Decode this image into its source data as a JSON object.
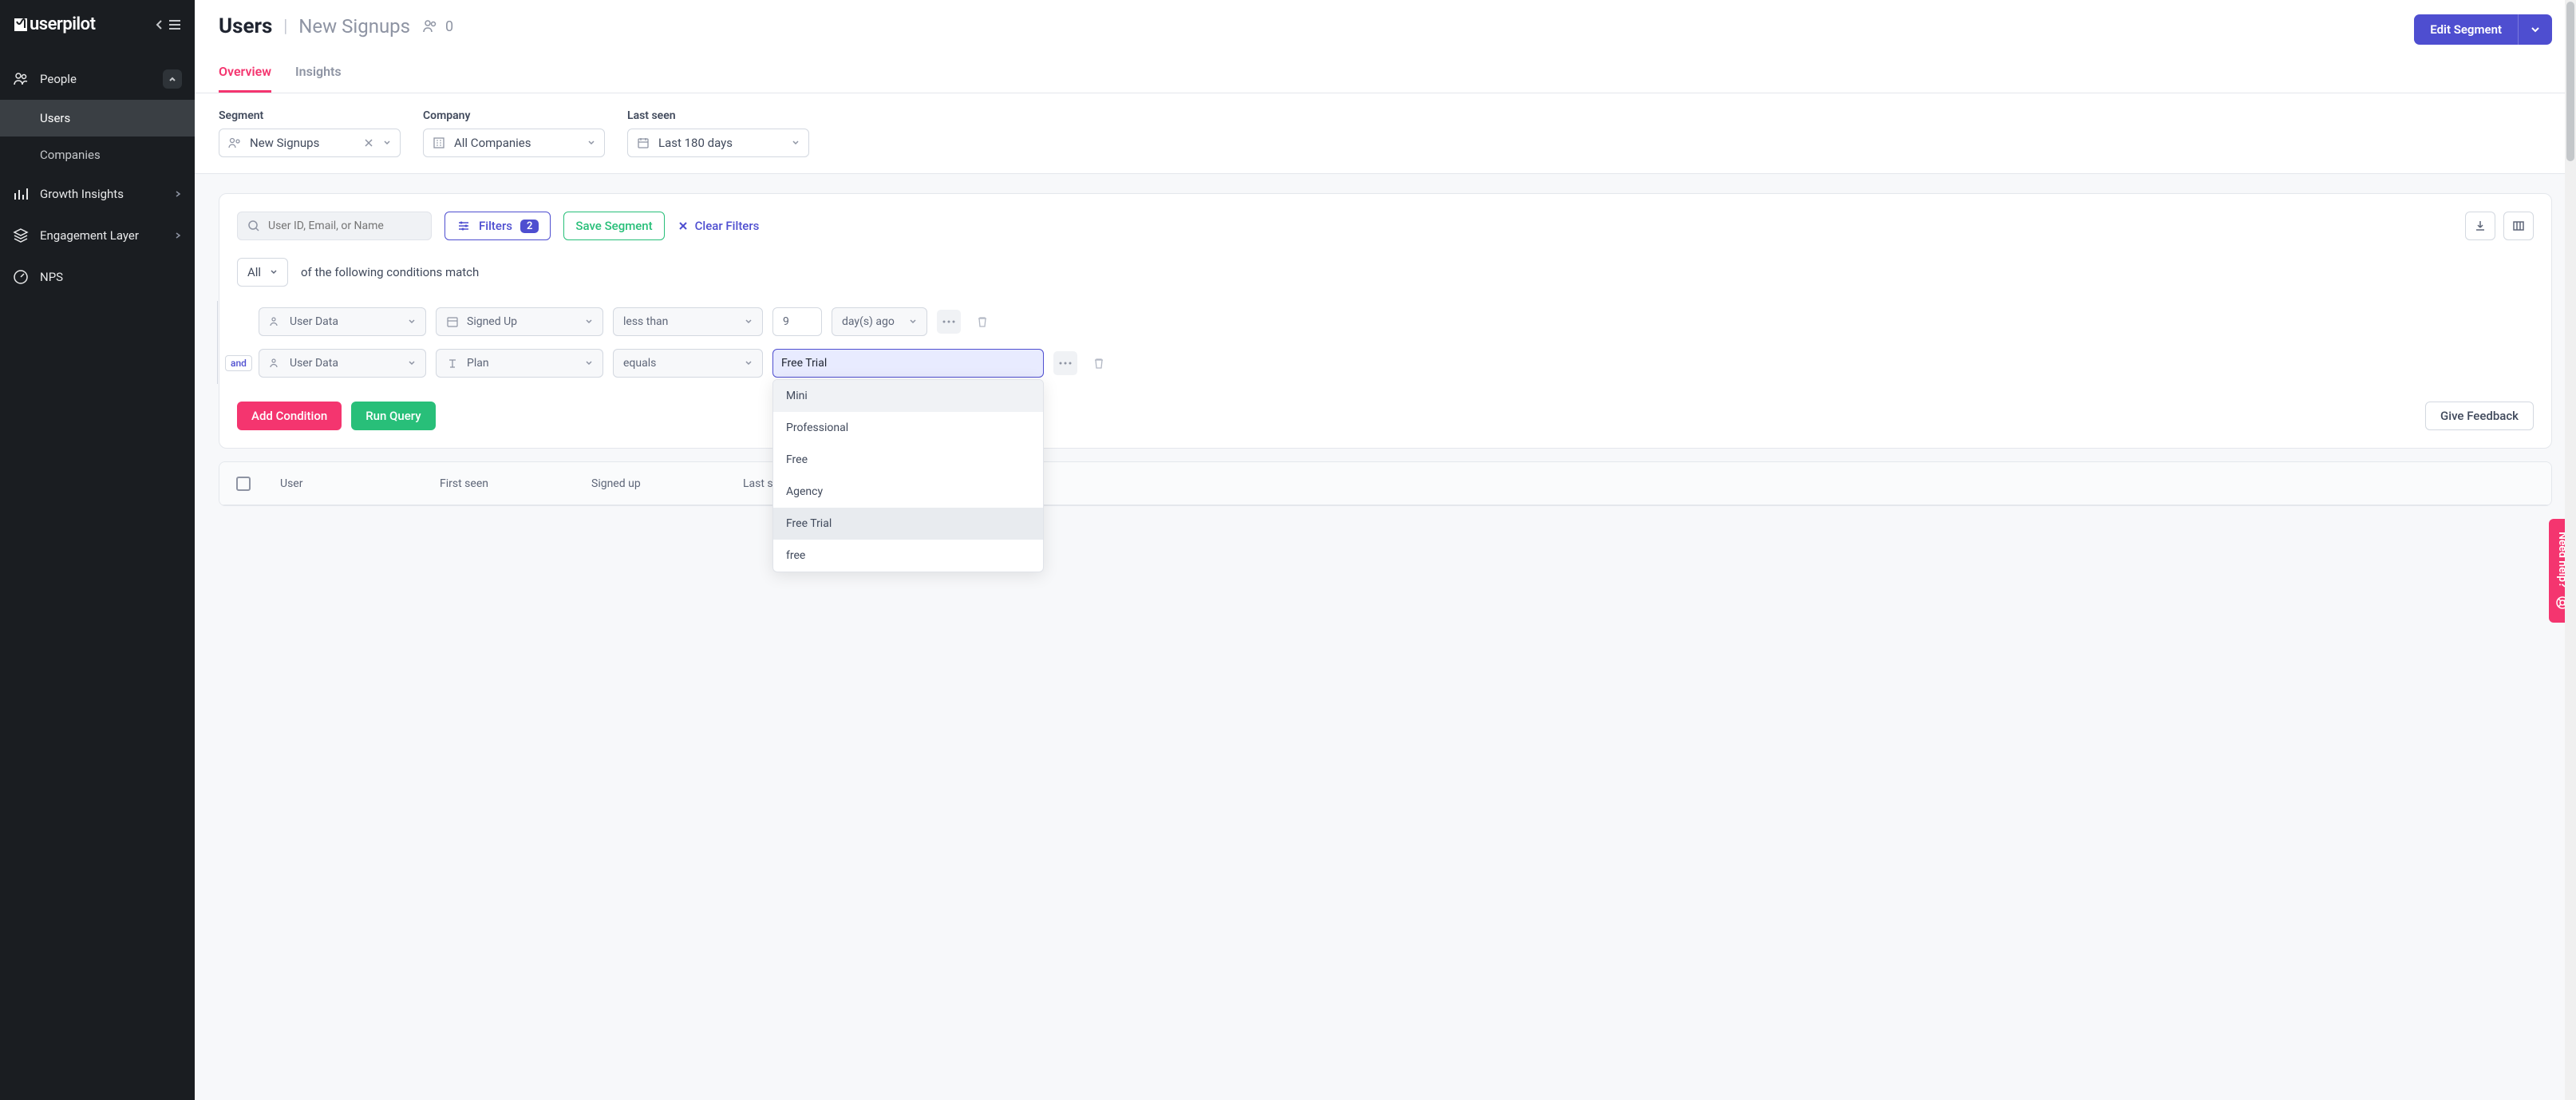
{
  "brand": {
    "name": "userpilot"
  },
  "sidebar": {
    "people": {
      "label": "People",
      "children": [
        {
          "label": "Users"
        },
        {
          "label": "Companies"
        }
      ]
    },
    "items": [
      {
        "label": "Growth Insights"
      },
      {
        "label": "Engagement Layer"
      },
      {
        "label": "NPS"
      }
    ]
  },
  "header": {
    "title": "Users",
    "subtitle": "New Signups",
    "count": "0",
    "edit_label": "Edit Segment"
  },
  "tabs": [
    {
      "label": "Overview"
    },
    {
      "label": "Insights"
    }
  ],
  "filters": {
    "segment": {
      "label": "Segment",
      "value": "New Signups"
    },
    "company": {
      "label": "Company",
      "value": "All Companies"
    },
    "lastseen": {
      "label": "Last seen",
      "value": "Last 180 days"
    }
  },
  "query": {
    "search_placeholder": "User ID, Email, or Name",
    "filters_label": "Filters",
    "filters_count": "2",
    "save_label": "Save Segment",
    "clear_label": "Clear Filters",
    "match_mode": "All",
    "match_text": "of the following conditions match",
    "rules": [
      {
        "source": "User Data",
        "field": "Signed Up",
        "op": "less than",
        "val": "9",
        "unit": "day(s) ago"
      },
      {
        "source": "User Data",
        "field": "Plan",
        "op": "equals",
        "val": "Free Trial"
      }
    ],
    "and_label": "and",
    "dropdown_options": [
      "Mini",
      "Professional",
      "Free",
      "Agency",
      "Free Trial",
      "free"
    ],
    "add_cond": "Add Condition",
    "run_query": "Run Query",
    "feedback": "Give Feedback"
  },
  "table": {
    "columns": [
      "User",
      "First seen",
      "Signed up",
      "Last seen"
    ]
  },
  "help": {
    "label": "Need help?"
  }
}
